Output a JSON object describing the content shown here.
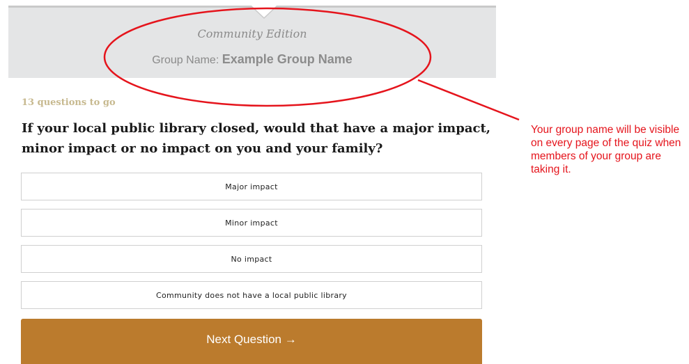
{
  "header": {
    "edition": "Community Edition",
    "group_label": "Group Name:",
    "group_name": "Example Group Name"
  },
  "quiz": {
    "progress": "13 questions to go",
    "question": "If your local public library closed, would that have a major impact, minor impact or no impact on you and your family?",
    "answers": [
      {
        "label": "Major impact"
      },
      {
        "label": "Minor impact"
      },
      {
        "label": "No impact"
      },
      {
        "label": "Community does not have a local public library"
      }
    ],
    "next_label": "Next Question →"
  },
  "annotation": {
    "text": "Your group name will be visible on every page of the quiz when members of your group are taking it.",
    "color": "#e5141c"
  },
  "colors": {
    "header_bg": "#e4e5e6",
    "button_bg": "#bb7b2d",
    "progress_text": "#c7b98f"
  }
}
